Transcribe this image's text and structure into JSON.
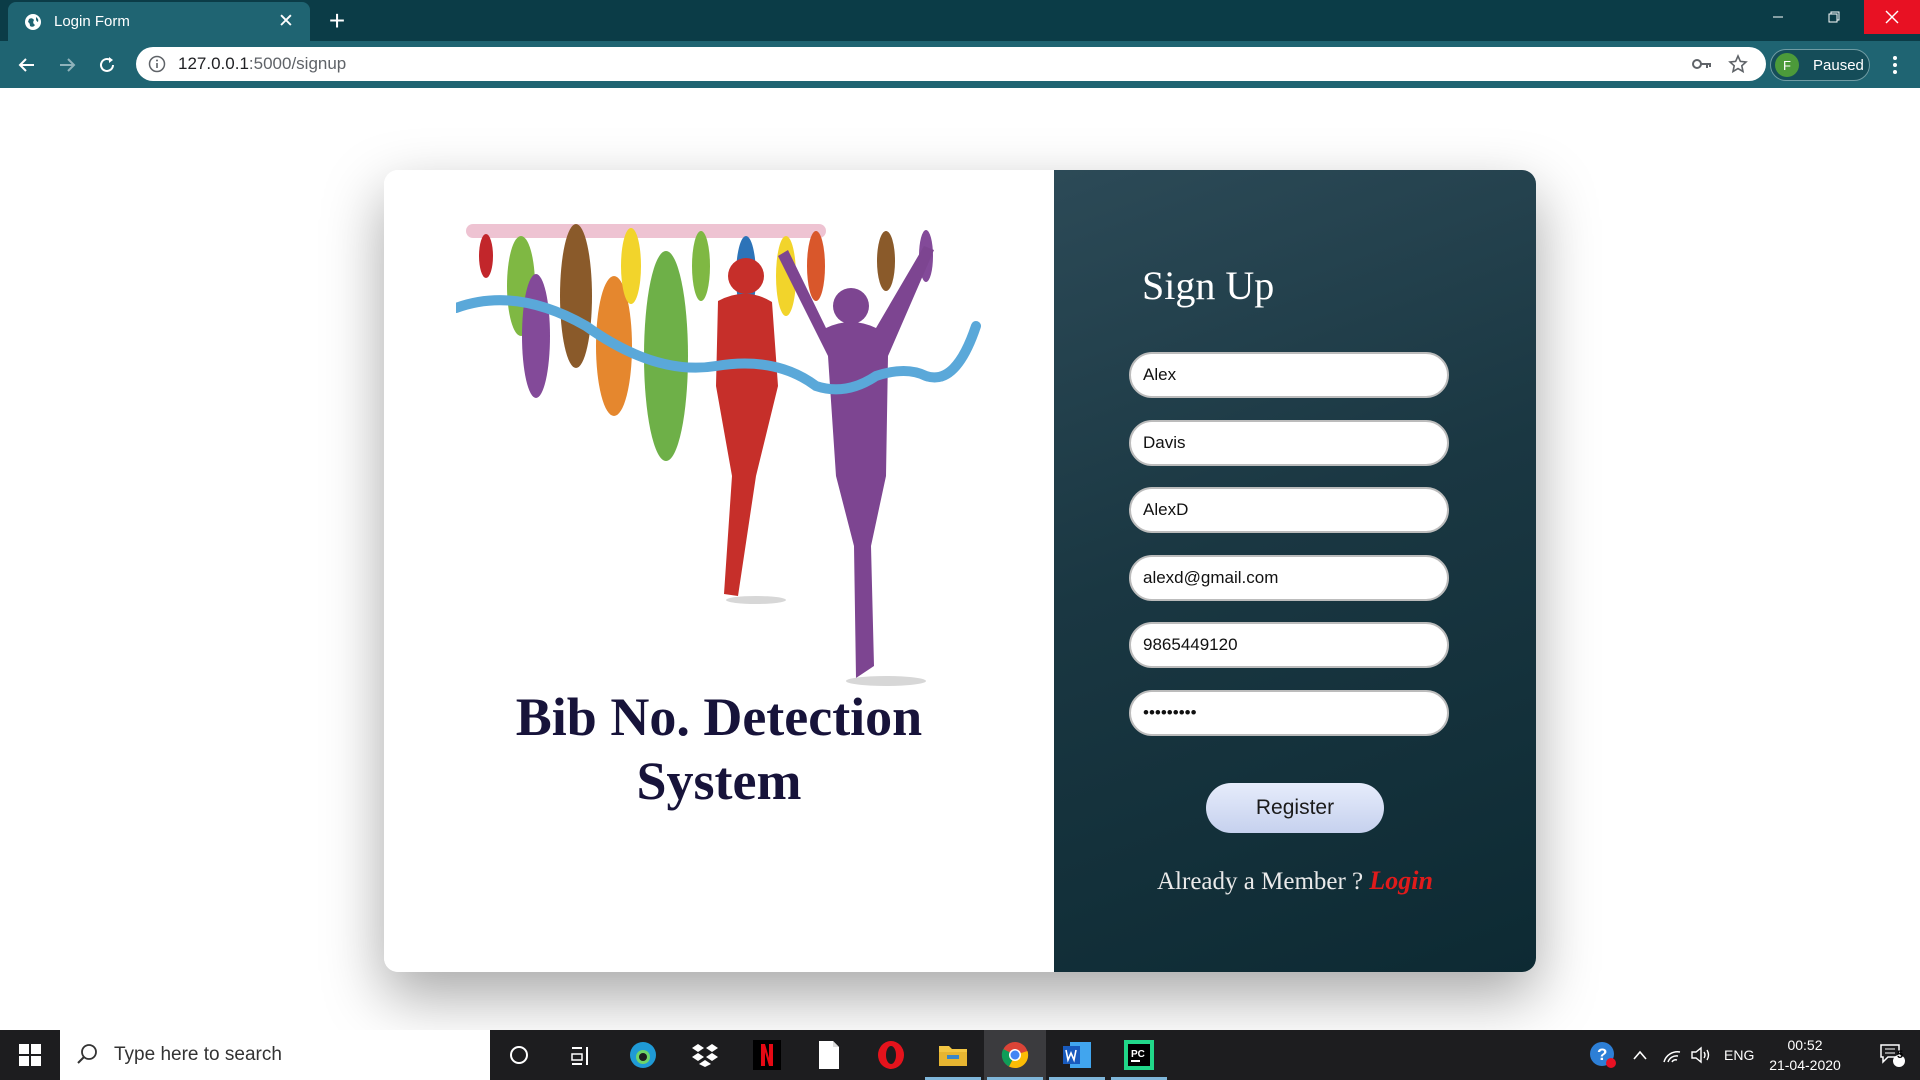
{
  "browser": {
    "tab_title": "Login Form",
    "url_host": "127.0.0.1",
    "url_rest": ":5000/signup",
    "profile_initial": "F",
    "profile_status": "Paused"
  },
  "page": {
    "brand_line1": "Bib No. Detection",
    "brand_line2": "System",
    "signup_title": "Sign Up",
    "fields": {
      "first_name": "Alex",
      "last_name": "Davis",
      "username": "AlexD",
      "email": "alexd@gmail.com",
      "phone": "9865449120",
      "password": "abcdefghi"
    },
    "register_label": "Register",
    "member_text": "Already a Member ? ",
    "login_link": "Login"
  },
  "taskbar": {
    "search_placeholder": "Type here to search",
    "language": "ENG",
    "time": "00:52",
    "date": "21-04-2020",
    "notification_count": "5",
    "apps": [
      "cortana-icon",
      "task-view-icon",
      "edge-icon",
      "dropbox-icon",
      "netflix-icon",
      "notes-icon",
      "opera-icon",
      "file-explorer-icon",
      "chrome-icon",
      "word-icon",
      "pycharm-icon"
    ]
  },
  "colors": {
    "chrome_dark": "#0b3c47",
    "chrome_tab": "#1f6472",
    "panel_dark": "#1a3742",
    "brand_text": "#17133a",
    "login_red": "#e01b1b",
    "close_red": "#e81123"
  }
}
